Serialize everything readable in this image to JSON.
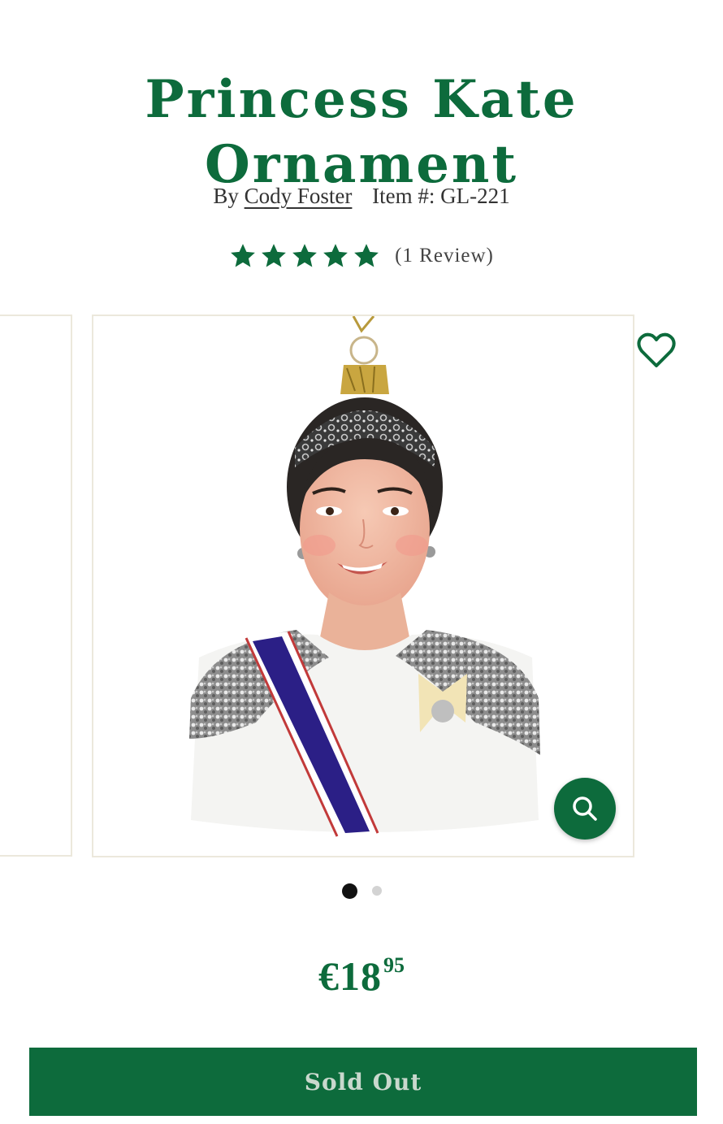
{
  "product": {
    "title_line1": "Princess Kate",
    "title_line2": "Ornament",
    "by_label": "By",
    "brand": "Cody Foster",
    "item_label": "Item #:",
    "item_number": "GL-221",
    "rating": {
      "stars": 5,
      "max": 5,
      "reviews_label": "(1 Review)"
    },
    "price": {
      "main": "€18",
      "cents": "95"
    },
    "button_label": "Sold Out"
  },
  "gallery": {
    "image_name": "princess-kate-ornament-image",
    "slide_count": 2,
    "active_slide": 1
  },
  "colors": {
    "brand_green": "#0d6b3c",
    "button_text": "#c9d8cd"
  },
  "icons": {
    "wishlist": "heart-icon",
    "zoom": "search-icon",
    "rating": "star-icon"
  }
}
